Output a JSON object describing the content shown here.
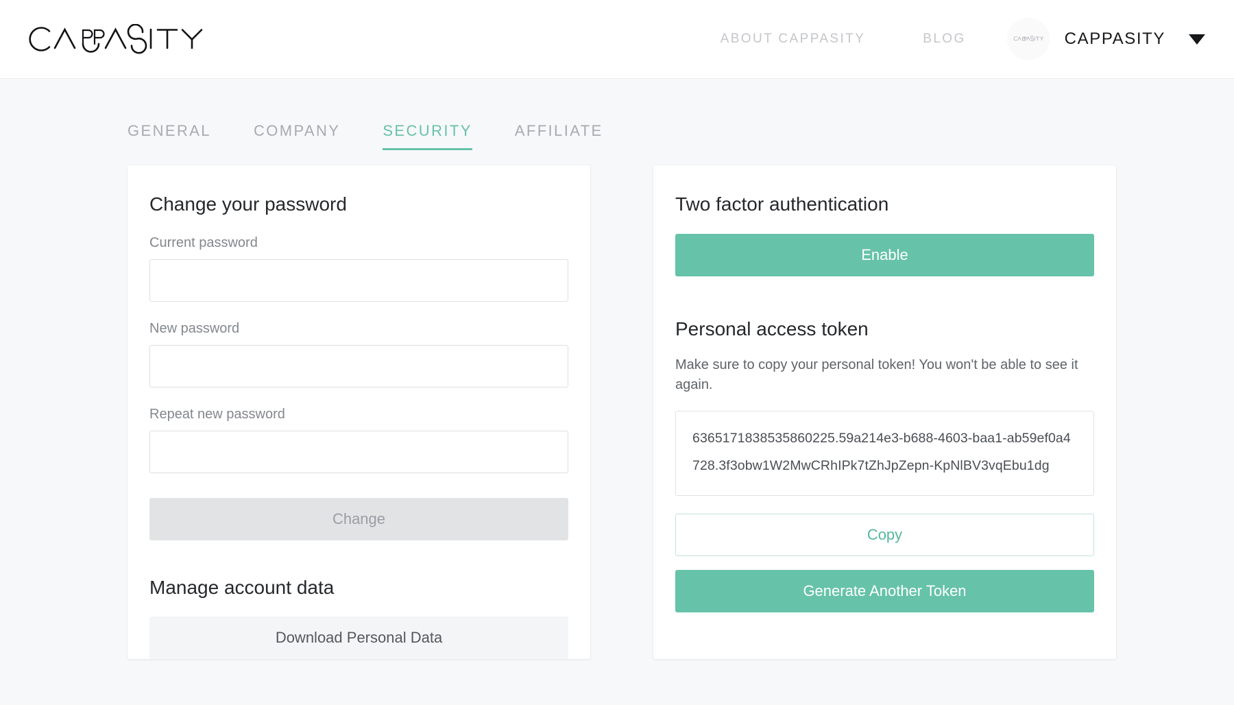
{
  "header": {
    "logo_text": "CAPPASITY",
    "nav": [
      {
        "label": "ABOUT CAPPASITY",
        "name": "nav-about-cappasity"
      },
      {
        "label": "BLOG",
        "name": "nav-blog"
      }
    ],
    "account": {
      "avatar_logo_text": "CAPPASITY",
      "name": "CAPPASITY",
      "caret": "chevron-down-icon"
    }
  },
  "tabs": [
    {
      "label": "GENERAL",
      "active": false
    },
    {
      "label": "COMPANY",
      "active": false
    },
    {
      "label": "SECURITY",
      "active": true
    },
    {
      "label": "AFFILIATE",
      "active": false
    }
  ],
  "password_card": {
    "title": "Change your password",
    "fields": [
      {
        "label": "Current password",
        "value": "",
        "placeholder": ""
      },
      {
        "label": "New password",
        "value": "",
        "placeholder": ""
      },
      {
        "label": "Repeat new password",
        "value": "",
        "placeholder": ""
      }
    ],
    "change_button": "Change",
    "manage_title": "Manage account data",
    "download_button": "Download Personal Data"
  },
  "security_card": {
    "twofa_title": "Two factor authentication",
    "enable_button": "Enable",
    "token_title": "Personal access token",
    "token_helper": "Make sure to copy your personal token! You won't be able to see it again.",
    "token_value": "6365171838535860225.59a214e3-b688-4603-baa1-ab59ef0a4728.3f3obw1W2MwCRhIPk7tZhJpZepn-KpNlBV3vqEbu1dg",
    "copy_button": "Copy",
    "generate_button": "Generate Another Token"
  },
  "colors": {
    "accent_green": "#66c2a8",
    "accent_green_soft": "#bfe4d8",
    "page_bg": "#f7f8f9",
    "muted_text": "#a7abaf",
    "disabled_bg": "#e2e3e5"
  }
}
